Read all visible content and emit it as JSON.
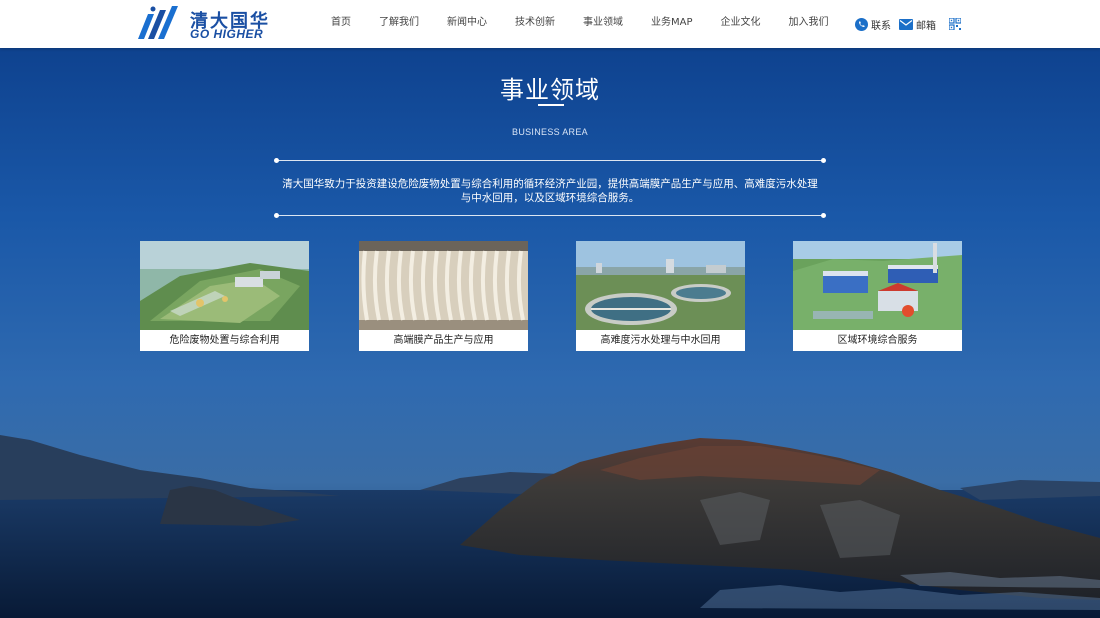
{
  "header": {
    "logo": {
      "cn": "清大国华",
      "en": "GO HIGHER"
    },
    "nav": [
      "首页",
      "了解我们",
      "新闻中心",
      "技术创新",
      "事业领域",
      "业务MAP",
      "企业文化",
      "加入我们"
    ],
    "contact_label": "联系",
    "mail_label": "邮箱"
  },
  "section": {
    "title": "事业领域",
    "subtitle": "BUSINESS AREA",
    "description_line1": "清大国华致力于投资建设危险废物处置与综合利用的循环经济产业园，提供高端膜产品生产与应用、高难度污水处理",
    "description_line2": "与中水回用，以及区域环境综合服务。"
  },
  "cards": [
    {
      "caption": "危险废物处置与综合利用"
    },
    {
      "caption": "高端膜产品生产与应用"
    },
    {
      "caption": "高难度污水处理与中水回用"
    },
    {
      "caption": "区域环境综合服务"
    }
  ],
  "colors": {
    "brand": "#1a4fa3",
    "sky_top": "#0d3f8a",
    "sea": "#0b2446"
  }
}
